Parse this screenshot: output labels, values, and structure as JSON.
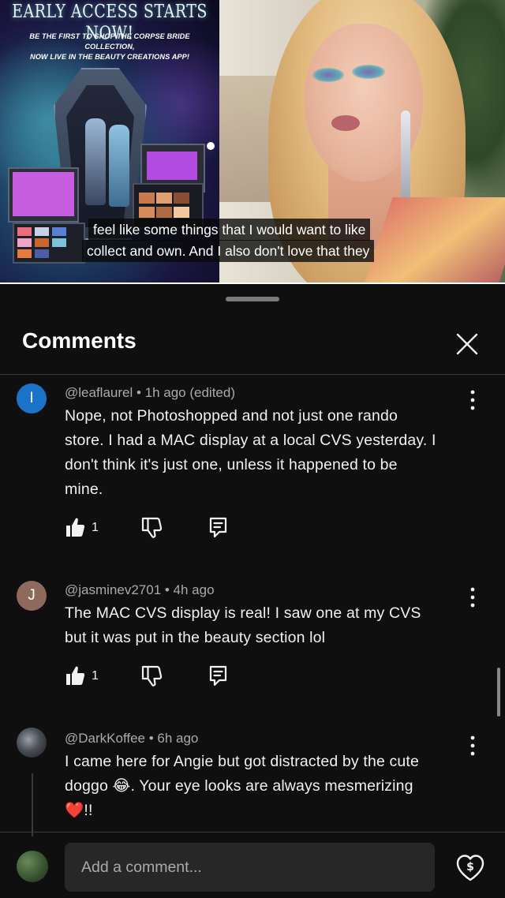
{
  "video": {
    "promo_title": "EARLY ACCESS STARTS NOW!",
    "promo_subtitle_line1": "BE THE FIRST TO SHOP THE CORPSE BRIDE COLLECTION,",
    "promo_subtitle_line2": "NOW LIVE IN THE BEAUTY CREATIONS APP!",
    "caption_line1": "feel like some things that I would want to like",
    "caption_line2": "collect and own. And I also don't love that they"
  },
  "sheet": {
    "title": "Comments"
  },
  "comments": [
    {
      "avatar_letter": "I",
      "avatar_color": "#1a73c9",
      "meta": "@leaflaurel • 1h ago (edited)",
      "text_line1": "Nope, not Photoshopped and not just one rando",
      "text_line2": "store. I had a MAC display at a local CVS yesterday. I",
      "text_line3": "don't think it's just one, unless it happened to be",
      "text_line4": "mine.",
      "likes": "1"
    },
    {
      "avatar_letter": "J",
      "avatar_color": "#8d6a5c",
      "meta": "@jasminev2701 • 4h ago",
      "text_line1": "The MAC CVS display is real! I saw one at my CVS",
      "text_line2": "but it was put in the beauty section lol",
      "likes": "1"
    },
    {
      "meta": "@DarkKoffee • 6h ago",
      "text_line1": "I came here for Angie but got distracted by the cute",
      "text_line2": "doggo 😂. Your eye looks are always mesmerizing",
      "text_line3": "❤️!!"
    }
  ],
  "composer": {
    "placeholder": "Add a comment..."
  },
  "colors": {
    "background": "#0f0f0f",
    "text_primary": "#f1f1f1",
    "text_secondary": "#aaaaaa",
    "input_bg": "#272727"
  },
  "icons": {
    "close": "close-icon",
    "more": "more-vert-icon",
    "like": "thumb-up-icon",
    "dislike": "thumb-down-icon",
    "reply": "reply-icon",
    "thanks": "super-thanks-icon"
  }
}
